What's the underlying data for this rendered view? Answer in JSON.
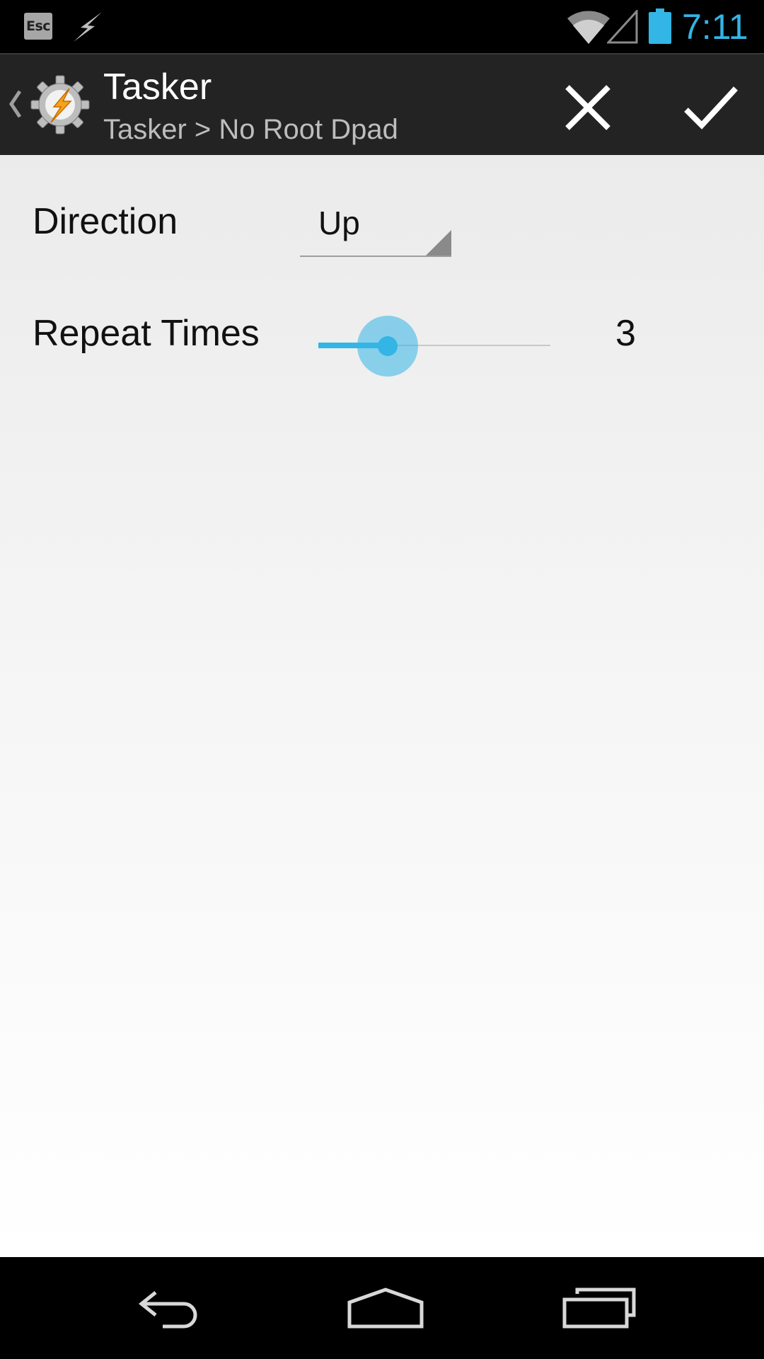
{
  "status_bar": {
    "notifications": [
      {
        "icon": "esc-icon",
        "label": "Esc"
      },
      {
        "icon": "lightning-bolt-icon"
      }
    ],
    "indicators": [
      "wifi-icon",
      "cell-signal-icon",
      "battery-icon"
    ],
    "time": "7:11",
    "time_color": "#33b5e5"
  },
  "action_bar": {
    "up_icon": "chevron-left-icon",
    "app_icon": "tasker-gear-bolt-icon",
    "title": "Tasker",
    "subtitle": "Tasker > No Root Dpad",
    "actions": [
      {
        "name": "cancel",
        "icon": "close-icon"
      },
      {
        "name": "done",
        "icon": "checkmark-icon"
      }
    ]
  },
  "form": {
    "direction": {
      "label": "Direction",
      "selected": "Up"
    },
    "repeat_times": {
      "label": "Repeat Times",
      "value": "3",
      "slider_fraction": 0.3
    }
  },
  "nav_bar": {
    "buttons": [
      "back-icon",
      "home-icon",
      "recents-icon"
    ]
  },
  "colors": {
    "accent": "#33b5e5",
    "action_bar_bg": "#232323",
    "app_icon_bolt": "#f7a21b"
  }
}
